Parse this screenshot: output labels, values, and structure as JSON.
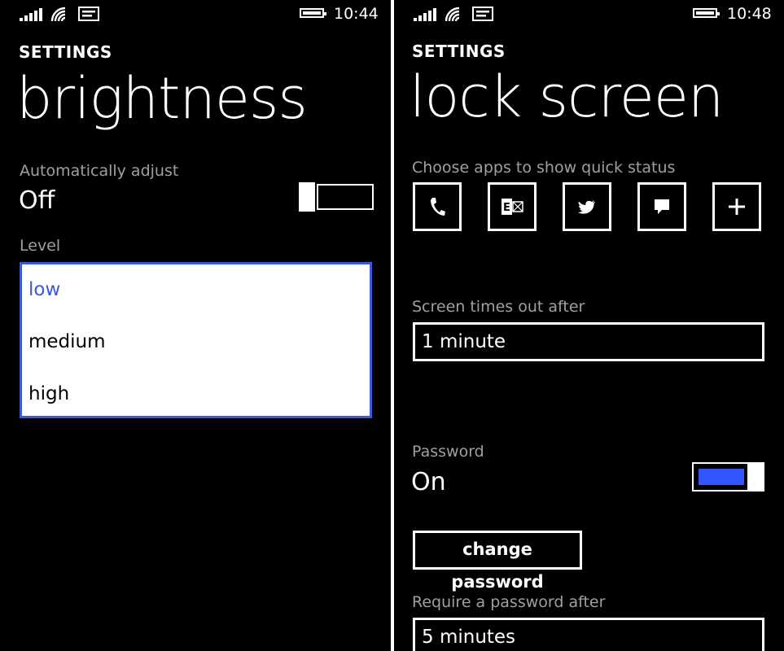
{
  "left_screen": {
    "status": {
      "time": "10:44"
    },
    "header": {
      "label": "SETTINGS",
      "title": "brightness"
    },
    "auto_adjust": {
      "label": "Automatically adjust",
      "value": "Off",
      "toggle_on": false
    },
    "level": {
      "label": "Level",
      "options": [
        "low",
        "medium",
        "high"
      ],
      "selected": "low"
    }
  },
  "right_screen": {
    "status": {
      "time": "10:48"
    },
    "header": {
      "label": "SETTINGS",
      "title": "lock screen"
    },
    "quick_status": {
      "label": "Choose apps to show quick status",
      "apps": [
        "phone-icon",
        "exchange-mail-icon",
        "twitter-icon",
        "messaging-icon",
        "add-icon"
      ]
    },
    "timeout": {
      "label": "Screen times out after",
      "value": "1 minute"
    },
    "password": {
      "label": "Password",
      "value": "On",
      "toggle_on": true,
      "change_button": "change password"
    },
    "require_password": {
      "label": "Require a password after",
      "value": "5 minutes"
    }
  },
  "colors": {
    "accent": "#3355ff",
    "background": "#000000",
    "label_gray": "#a0a0a0"
  }
}
